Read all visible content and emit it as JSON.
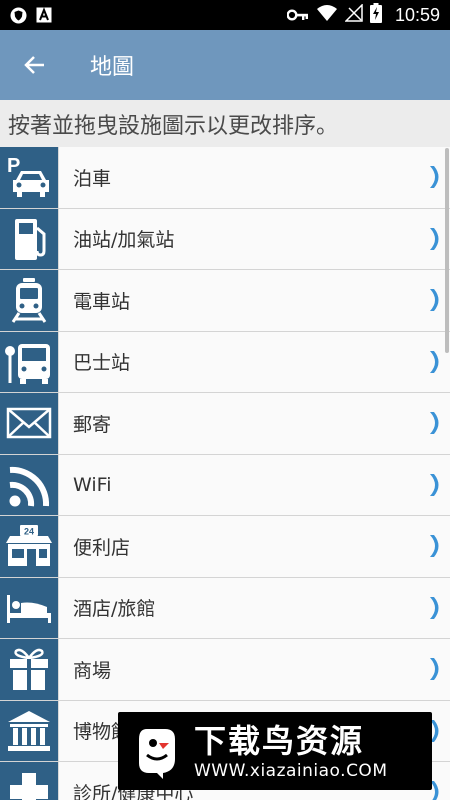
{
  "status_bar": {
    "time": "10:59",
    "icons": [
      "shield-icon",
      "font-a-icon",
      "key-icon",
      "wifi-icon",
      "no-signal-icon",
      "battery-charging-icon"
    ]
  },
  "toolbar": {
    "title": "地圖",
    "back_icon": "arrow-left-icon"
  },
  "instruction": "按著並拖曳設施圖示以更改排序。",
  "items": [
    {
      "label": "泊車",
      "icon": "parking-car-icon"
    },
    {
      "label": "油站/加氣站",
      "icon": "fuel-pump-icon"
    },
    {
      "label": "電車站",
      "icon": "tram-icon"
    },
    {
      "label": "巴士站",
      "icon": "bus-stop-icon"
    },
    {
      "label": "郵寄",
      "icon": "envelope-icon"
    },
    {
      "label": "WiFi",
      "icon": "wifi-signal-icon"
    },
    {
      "label": "便利店",
      "icon": "convenience-store-icon"
    },
    {
      "label": "酒店/旅館",
      "icon": "hotel-bed-icon"
    },
    {
      "label": "商場",
      "icon": "gift-box-icon"
    },
    {
      "label": "博物館",
      "icon": "museum-icon"
    },
    {
      "label": "診所/健康中心",
      "icon": "medical-cross-icon"
    }
  ],
  "colors": {
    "toolbar": "#6f97bd",
    "icon_tile": "#2f6086",
    "chevron": "#3a92d6"
  },
  "watermark": {
    "title": "下载鸟资源",
    "url": "WWW.xiazainiao.COM"
  }
}
